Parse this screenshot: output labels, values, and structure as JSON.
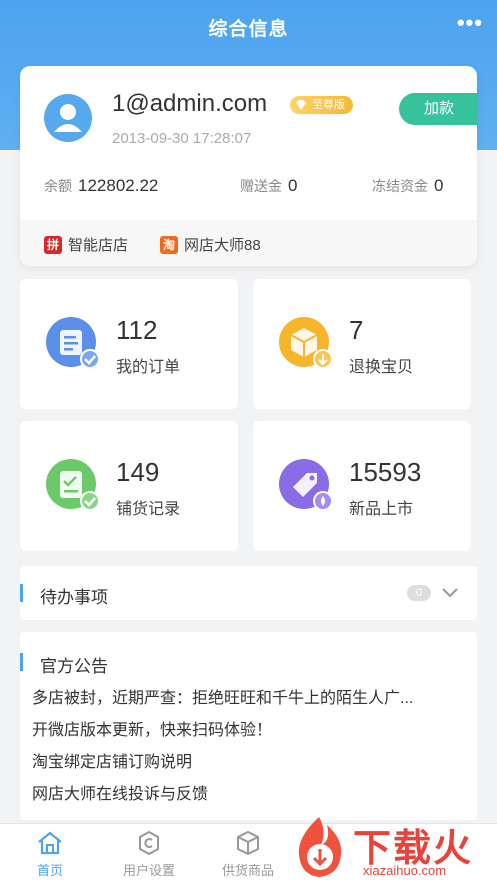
{
  "header": {
    "title": "综合信息",
    "more_label": "•••"
  },
  "account": {
    "email": "1@admin.com",
    "badge": "至尊版",
    "reg_time": "2013-09-30 17:28:07",
    "add_funds_label": "加款",
    "balance_label": "余额",
    "balance": "122802.22",
    "gift_label": "赠送金",
    "gift": "0",
    "frozen_label": "冻结资金",
    "frozen": "0",
    "stores": [
      {
        "icon_text": "拼",
        "icon_color": "#d8282a",
        "name": "智能店店"
      },
      {
        "icon_text": "淘",
        "icon_color": "#f26b1d",
        "name": "网店大师88"
      }
    ]
  },
  "tiles": [
    {
      "count": "112",
      "label": "我的订单",
      "icon": "order-icon",
      "color": "#5c8fe8"
    },
    {
      "count": "7",
      "label": "退换宝贝",
      "icon": "return-box-icon",
      "color": "#f7b52c"
    },
    {
      "count": "149",
      "label": "铺货记录",
      "icon": "distribution-record-icon",
      "color": "#6cc96a"
    },
    {
      "count": "15593",
      "label": "新品上市",
      "icon": "new-product-tag-icon",
      "color": "#8a6ce6"
    }
  ],
  "todo": {
    "title": "待办事项",
    "count": "0"
  },
  "notice": {
    "title": "官方公告",
    "items": [
      "多店被封，近期严查：拒绝旺旺和千牛上的陌生人广...",
      "开微店版本更新，快来扫码体验！",
      "淘宝绑定店铺订购说明",
      "网店大师在线投诉与反馈"
    ]
  },
  "tabbar": [
    {
      "label": "首页",
      "icon": "home-icon",
      "active": true
    },
    {
      "label": "用户设置",
      "icon": "settings-icon",
      "active": false
    },
    {
      "label": "供货商品",
      "icon": "box-icon",
      "active": false
    }
  ],
  "watermark": {
    "text": "下载火",
    "sub": "xiazaihuo.com"
  },
  "colors": {
    "primary": "#4da3ee",
    "accent_green": "#36c29b"
  }
}
